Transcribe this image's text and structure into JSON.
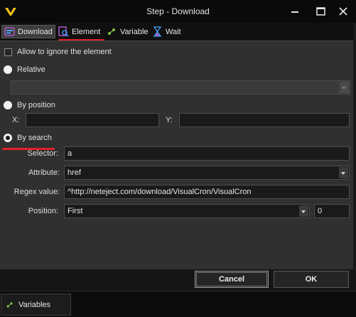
{
  "window": {
    "title": "Step - Download"
  },
  "tabs": [
    {
      "label": "Download"
    },
    {
      "label": "Element"
    },
    {
      "label": "Variable"
    },
    {
      "label": "Wait"
    }
  ],
  "options": {
    "allow_ignore_label": "Allow to ignore the element",
    "relative_label": "Relative",
    "by_position_label": "By position",
    "by_search_label": "By search"
  },
  "position": {
    "x_label": "X:",
    "y_label": "Y:",
    "x_value": "",
    "y_value": ""
  },
  "search": {
    "selector_label": "Selector:",
    "selector_value": "a",
    "attribute_label": "Attribute:",
    "attribute_value": "href",
    "regex_label": "Regex value:",
    "regex_value": "^http://neteject.com/download/VisualCron/VisualCron",
    "position_label": "Position:",
    "position_value": "First",
    "position_index": "0"
  },
  "buttons": {
    "cancel": "Cancel",
    "ok": "OK"
  },
  "bottom_tabs": {
    "variables": "Variables"
  },
  "colors": {
    "accent_red": "#e3202a",
    "logo_yellow": "#f2c21b",
    "variable_green": "#7fc24a"
  },
  "icons": [
    "app-logo-icon",
    "minimize-icon",
    "maximize-icon",
    "close-icon",
    "download-icon",
    "element-icon",
    "variable-icon",
    "wait-icon"
  ]
}
